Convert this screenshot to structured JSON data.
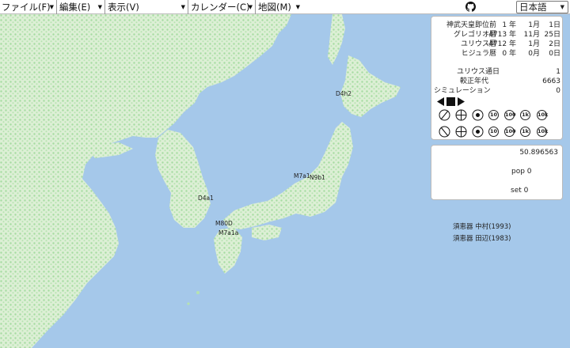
{
  "menubar": {
    "items": [
      {
        "label": "ファイル(F)"
      },
      {
        "label": "編集(E)"
      },
      {
        "label": "表示(V)"
      },
      {
        "label": "カレンダー(C)"
      },
      {
        "label": "地図(M)"
      }
    ],
    "language": "日本語"
  },
  "calendar": {
    "rows": [
      {
        "name": "神武天皇即位前",
        "year": "1 年",
        "month": "1月",
        "day": "1日"
      },
      {
        "name": "グレゴリオ暦",
        "year": "-4713 年",
        "month": "11月",
        "day": "25日"
      },
      {
        "name": "ユリウス暦",
        "year": "-4712 年",
        "month": "1月",
        "day": "2日"
      },
      {
        "name": "ヒジュラ暦",
        "year": "0 年",
        "month": "0月",
        "day": "0日"
      }
    ],
    "julian_day_label": "ユリウス通日",
    "julian_day_value": "1",
    "calibrated_label": "較正年代",
    "calibrated_value": "6663",
    "simulation_label": "シミュレーション",
    "simulation_value": "0"
  },
  "speed_controls": {
    "row1": [
      "",
      "",
      "",
      "10",
      "100",
      "1k",
      "10k"
    ],
    "row2": [
      "",
      "",
      "",
      "10",
      "100",
      "1k",
      "10k"
    ]
  },
  "population": {
    "value": "50.896563",
    "pop_label": "pop 0",
    "set_label": "set 0"
  },
  "map_labels": {
    "sites": [
      {
        "text": "D4h2"
      },
      {
        "text": "M7a1"
      },
      {
        "text": "N9b1"
      },
      {
        "text": "D4a1"
      },
      {
        "text": "M80D"
      },
      {
        "text": "M7a1a"
      }
    ],
    "captions": [
      {
        "text": "須恵器 中村(1993)"
      },
      {
        "text": "須恵器 田辺(1983)"
      }
    ]
  },
  "colors": {
    "sea": "#a5c8ea",
    "land": "#ddeed6",
    "forest": "#aedfa9"
  }
}
